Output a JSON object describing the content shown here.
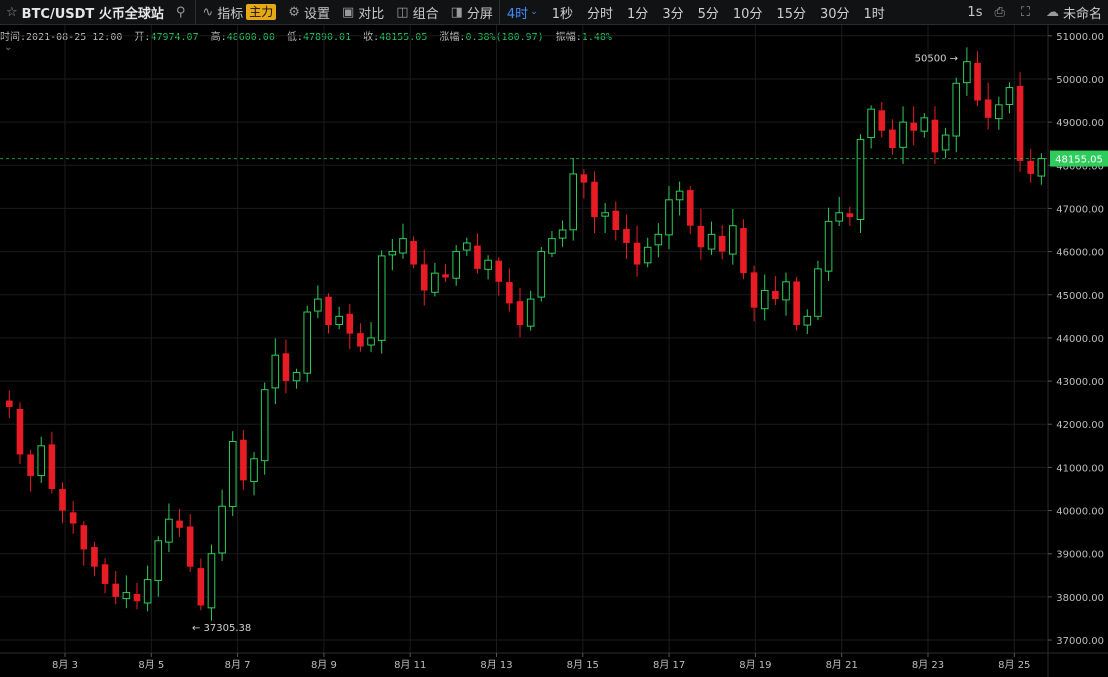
{
  "toolbar": {
    "symbol": "BTC/USDT 火币全球站",
    "indicator_label": "指标",
    "indicator_badge": "主力",
    "settings_label": "设置",
    "compare_label": "对比",
    "combo_label": "组合",
    "split_label": "分屏",
    "active_period": "4时",
    "periods": [
      "1秒",
      "分时",
      "1分",
      "3分",
      "5分",
      "10分",
      "15分",
      "30分",
      "1时"
    ],
    "refresh_label": "1s",
    "unnamed_label": "未命名"
  },
  "info": {
    "time_label": "时间:",
    "time": "2021-08-25 12:00",
    "open_label": "开:",
    "open": "47974.07",
    "high_label": "高:",
    "high": "48600.00",
    "low_label": "低:",
    "low": "47890.01",
    "close_label": "收:",
    "close": "48155.05",
    "change_label": "涨幅:",
    "change": "0.38%(180.97)",
    "amp_label": "振幅:",
    "amp": "1.48%"
  },
  "chart_data": {
    "type": "candlestick",
    "ylim": [
      36700,
      51250
    ],
    "y_ticks": [
      "37000.00",
      "38000.00",
      "39000.00",
      "40000.00",
      "41000.00",
      "42000.00",
      "43000.00",
      "44000.00",
      "45000.00",
      "46000.00",
      "47000.00",
      "48000.00",
      "49000.00",
      "50000.00",
      "51000.00"
    ],
    "x_ticks": [
      "8月 3",
      "8月 5",
      "8月 7",
      "8月 9",
      "8月 11",
      "8月 13",
      "8月 15",
      "8月 17",
      "8月 19",
      "8月 21",
      "8月 23",
      "8月 25"
    ],
    "current_price": "48155.05",
    "max_label": "50500 →",
    "min_label": "← 37305.38",
    "colors": {
      "up": "#2ecc5a",
      "down": "#e81c24",
      "price_line": "#2ecc5a"
    },
    "approx_path": [
      42400,
      41300,
      40800,
      41500,
      40500,
      40000,
      39700,
      39100,
      38700,
      38300,
      38000,
      38100,
      37900,
      38400,
      39300,
      39800,
      39600,
      38700,
      37800,
      39000,
      40100,
      41600,
      40700,
      41200,
      42800,
      43600,
      43000,
      43200,
      44600,
      44900,
      44300,
      44500,
      44100,
      43800,
      44000,
      45900,
      46000,
      46300,
      45700,
      45100,
      45500,
      45400,
      46000,
      46200,
      45600,
      45800,
      45300,
      44800,
      44300,
      44900,
      46000,
      46300,
      46500,
      47800,
      47600,
      46800,
      46900,
      46500,
      46200,
      45700,
      46100,
      46400,
      47200,
      47400,
      46600,
      46100,
      46400,
      46000,
      46600,
      45500,
      44700,
      45100,
      44900,
      45300,
      44300,
      44500,
      45600,
      46700,
      46900,
      46800,
      48600,
      49300,
      48800,
      48400,
      49000,
      48800,
      49100,
      48300,
      48700,
      49900,
      50400,
      49500,
      49100,
      49400,
      49800,
      48100,
      47800,
      48155
    ]
  }
}
